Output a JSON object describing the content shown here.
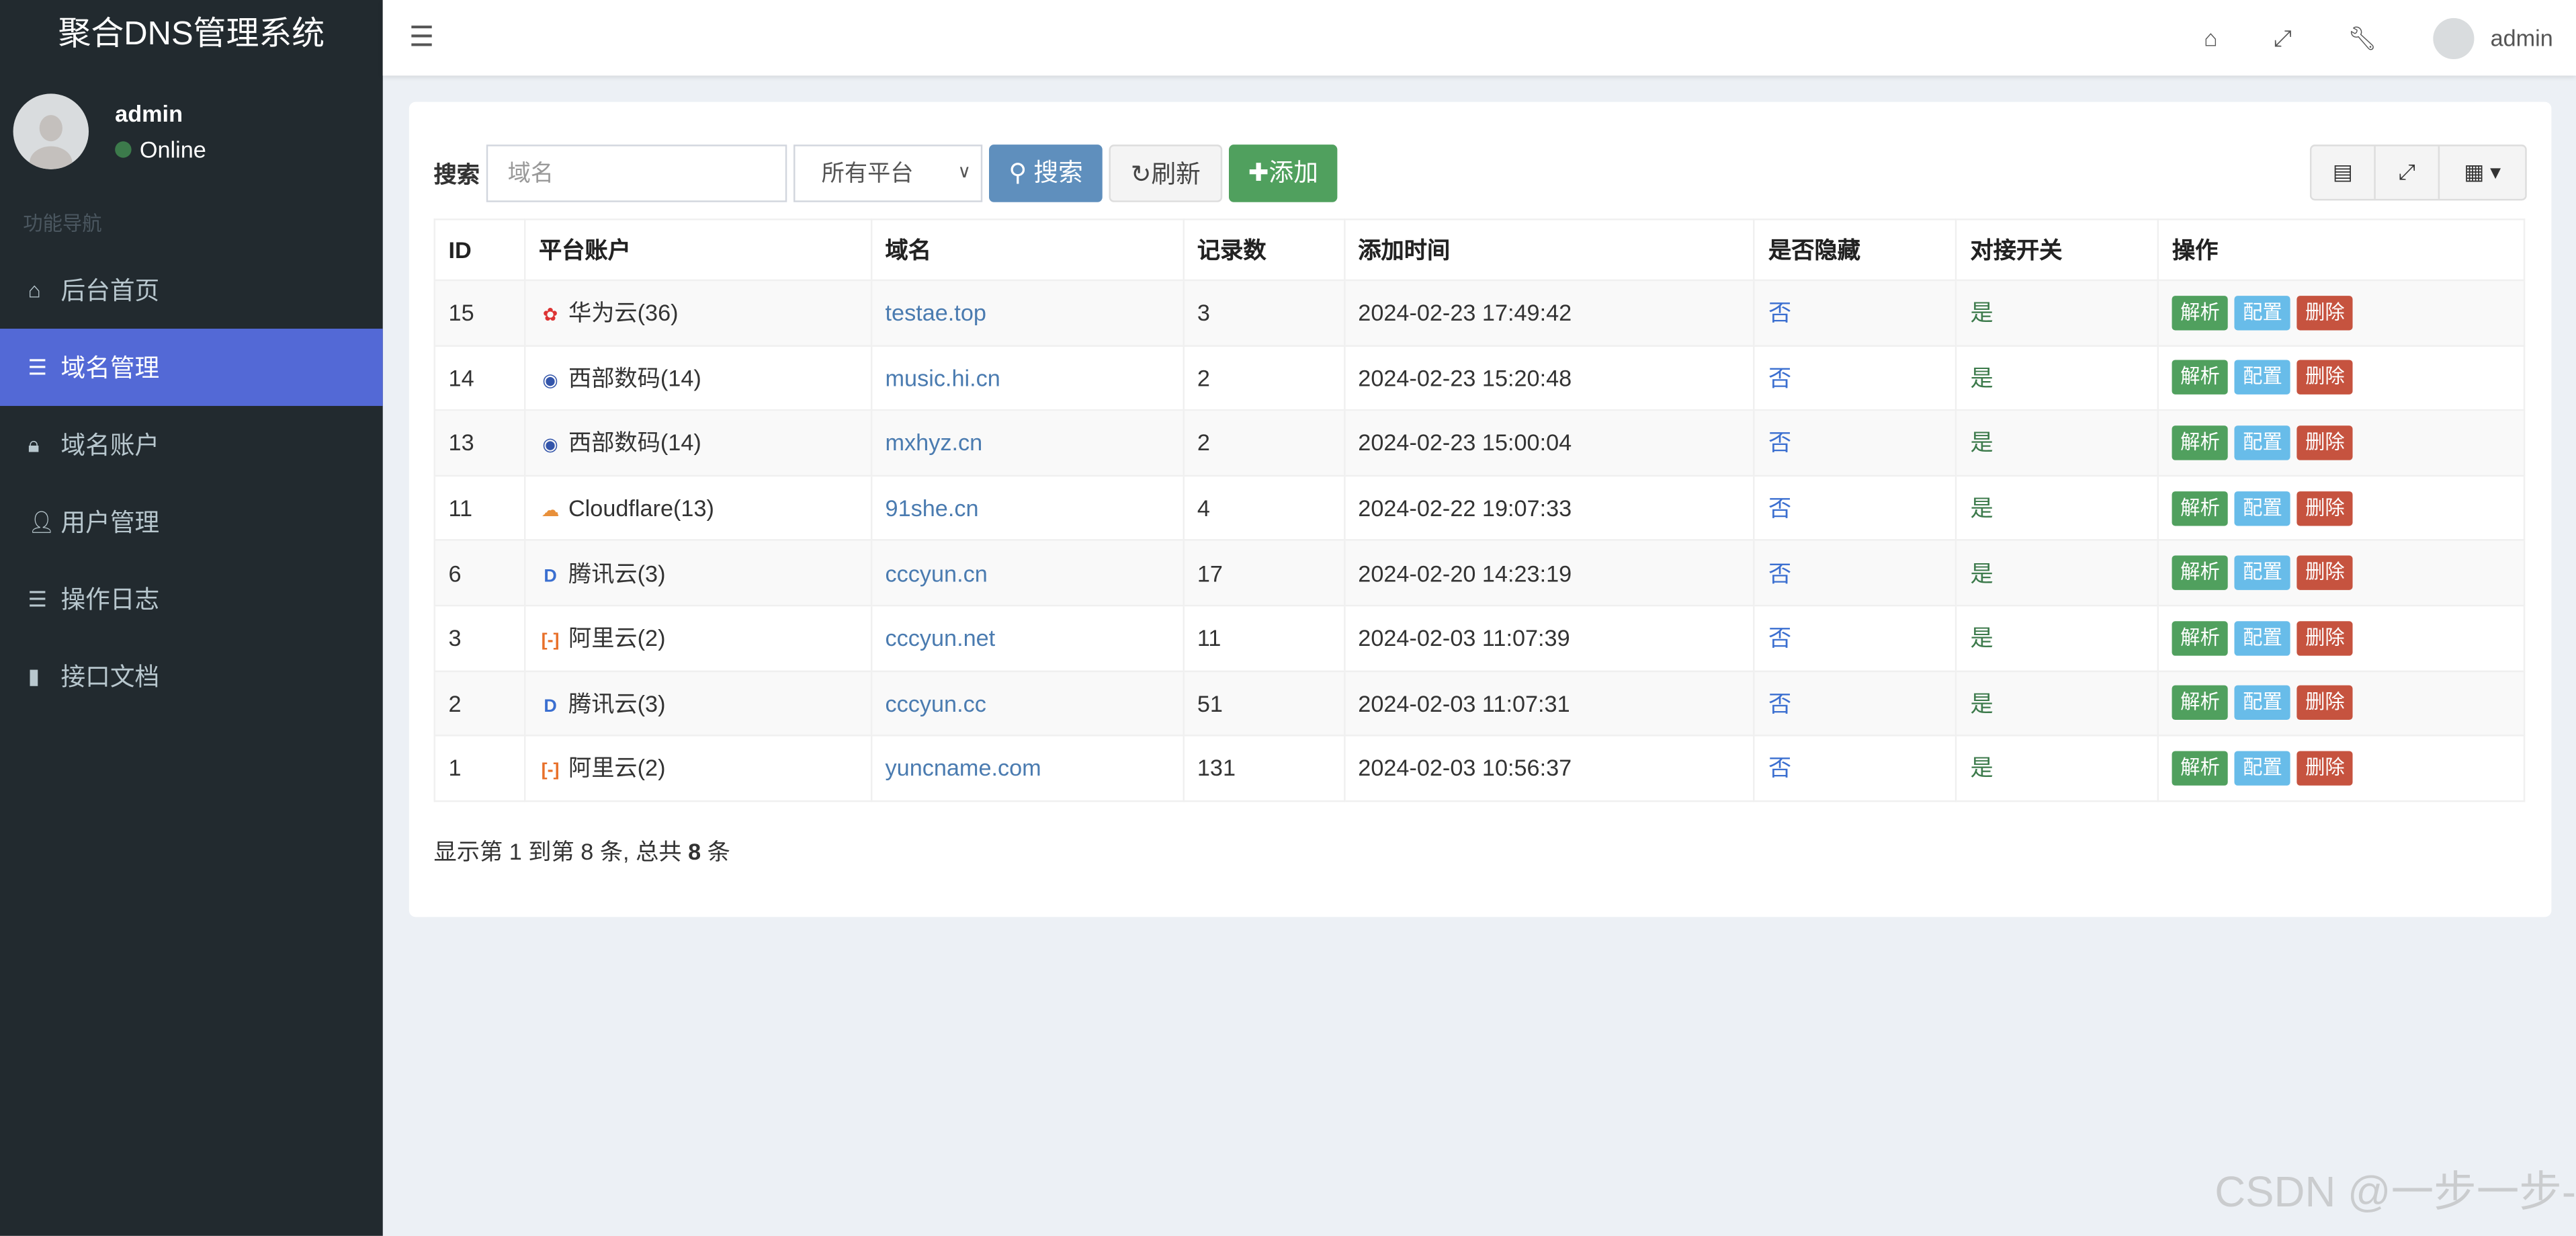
{
  "app": {
    "title": "聚合DNS管理系统"
  },
  "user": {
    "name": "admin",
    "status": "Online"
  },
  "sidebar": {
    "heading": "功能导航",
    "items": [
      {
        "label": "后台首页",
        "icon": "home-icon"
      },
      {
        "label": "域名管理",
        "icon": "list-icon",
        "active": true
      },
      {
        "label": "域名账户",
        "icon": "lock-icon"
      },
      {
        "label": "用户管理",
        "icon": "user-icon"
      },
      {
        "label": "操作日志",
        "icon": "list-icon"
      },
      {
        "label": "接口文档",
        "icon": "book-icon"
      }
    ]
  },
  "topbar": {
    "user": "admin"
  },
  "toolbar": {
    "search_label": "搜索",
    "search_placeholder": "域名",
    "platform_select": "所有平台",
    "search_btn": "搜索",
    "refresh_btn": "刷新",
    "add_btn": "添加"
  },
  "table": {
    "headers": [
      "ID",
      "平台账户",
      "域名",
      "记录数",
      "添加时间",
      "是否隐藏",
      "对接开关",
      "操作"
    ],
    "rows": [
      {
        "id": "15",
        "platform": "华为云(36)",
        "icon": "huawei",
        "domain": "testae.top",
        "records": "3",
        "time": "2024-02-23 17:49:42",
        "hidden": "否",
        "enabled": "是"
      },
      {
        "id": "14",
        "platform": "西部数码(14)",
        "icon": "west",
        "domain": "music.hi.cn",
        "records": "2",
        "time": "2024-02-23 15:20:48",
        "hidden": "否",
        "enabled": "是"
      },
      {
        "id": "13",
        "platform": "西部数码(14)",
        "icon": "west",
        "domain": "mxhyz.cn",
        "records": "2",
        "time": "2024-02-23 15:00:04",
        "hidden": "否",
        "enabled": "是"
      },
      {
        "id": "11",
        "platform": "Cloudflare(13)",
        "icon": "cloudflare",
        "domain": "91she.cn",
        "records": "4",
        "time": "2024-02-22 19:07:33",
        "hidden": "否",
        "enabled": "是"
      },
      {
        "id": "6",
        "platform": "腾讯云(3)",
        "icon": "dnspod",
        "domain": "cccyun.cn",
        "records": "17",
        "time": "2024-02-20 14:23:19",
        "hidden": "否",
        "enabled": "是"
      },
      {
        "id": "3",
        "platform": "阿里云(2)",
        "icon": "aliyun",
        "domain": "cccyun.net",
        "records": "11",
        "time": "2024-02-03 11:07:39",
        "hidden": "否",
        "enabled": "是"
      },
      {
        "id": "2",
        "platform": "腾讯云(3)",
        "icon": "dnspod",
        "domain": "cccyun.cc",
        "records": "51",
        "time": "2024-02-03 11:07:31",
        "hidden": "否",
        "enabled": "是"
      },
      {
        "id": "1",
        "platform": "阿里云(2)",
        "icon": "aliyun",
        "domain": "yuncname.com",
        "records": "131",
        "time": "2024-02-03 10:56:37",
        "hidden": "否",
        "enabled": "是"
      }
    ],
    "actions": [
      "解析",
      "配置",
      "删除"
    ]
  },
  "summary": {
    "prefix": "显示第 1 到第 8 条, 总共 ",
    "total": "8",
    "suffix": " 条"
  },
  "watermark": "CSDN @一步一步-"
}
